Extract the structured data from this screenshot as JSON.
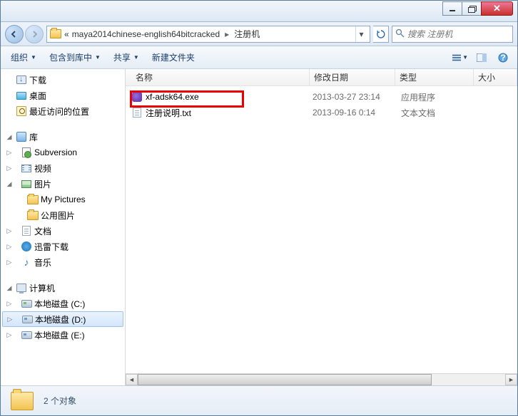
{
  "titlebar": {},
  "address": {
    "prefix": "«",
    "path1": "maya2014chinese-english64bitcracked",
    "path2": "注册机",
    "search_placeholder": "搜索 注册机"
  },
  "toolbar": {
    "organize": "组织",
    "include": "包含到库中",
    "share": "共享",
    "newfolder": "新建文件夹"
  },
  "columns": {
    "name": "名称",
    "date": "修改日期",
    "type": "类型",
    "size": "大小"
  },
  "sidebar": {
    "downloads": "下载",
    "desktop": "桌面",
    "recent": "最近访问的位置",
    "libraries": "库",
    "subversion": "Subversion",
    "videos": "视频",
    "pictures": "图片",
    "mypictures": "My Pictures",
    "publicpics": "公用图片",
    "documents": "文档",
    "xunlei": "迅雷下载",
    "music": "音乐",
    "computer": "计算机",
    "drive_c": "本地磁盘 (C:)",
    "drive_d": "本地磁盘 (D:)",
    "drive_e": "本地磁盘 (E:)"
  },
  "files": [
    {
      "name": "xf-adsk64.exe",
      "date": "2013-03-27 23:14",
      "type": "应用程序",
      "icon": "exe",
      "highlighted": true
    },
    {
      "name": "注册说明.txt",
      "date": "2013-09-16 0:14",
      "type": "文本文档",
      "icon": "txt",
      "highlighted": false
    }
  ],
  "status": {
    "text": "2 个对象"
  }
}
